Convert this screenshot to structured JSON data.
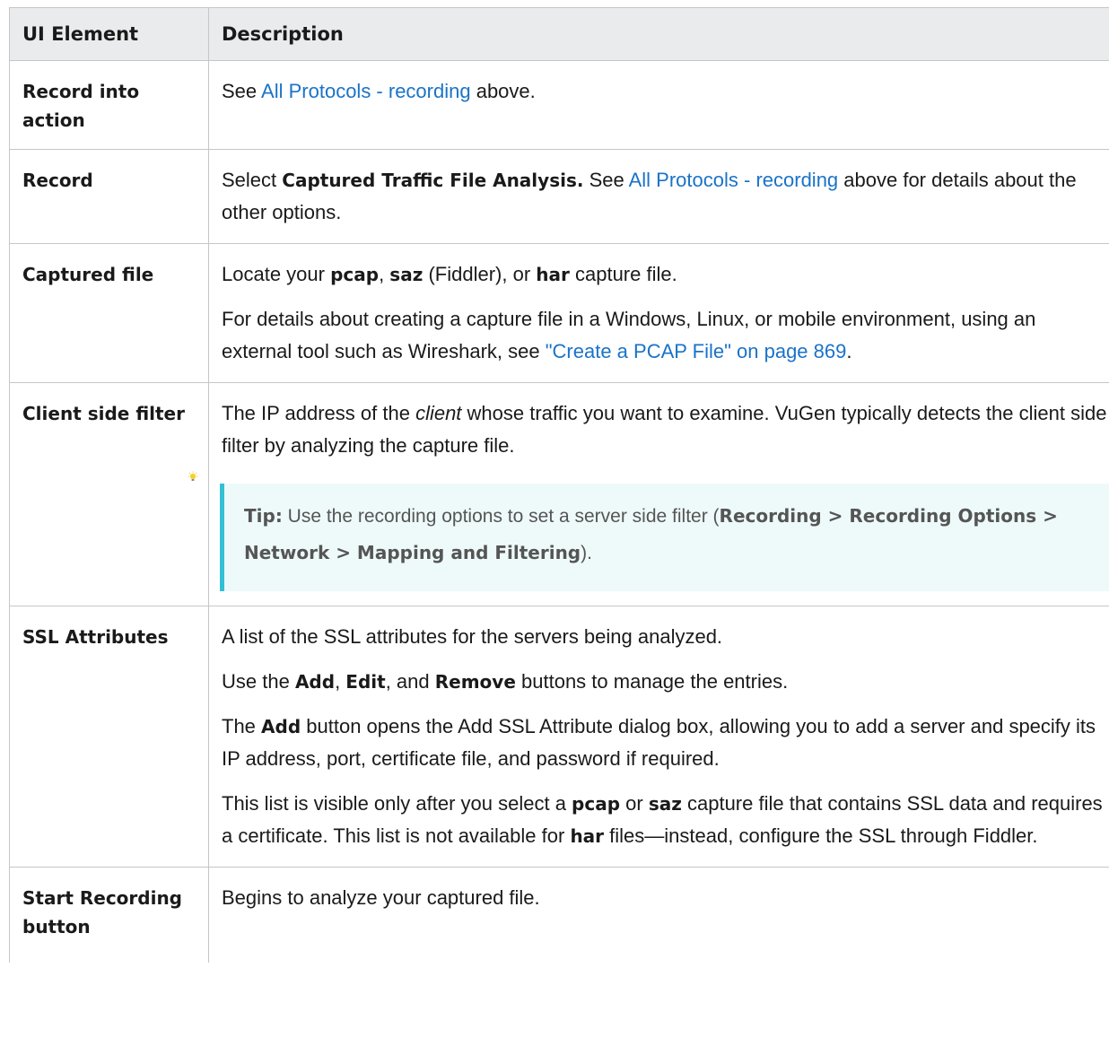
{
  "header": {
    "col1": "UI Element",
    "col2": "Description"
  },
  "rows": {
    "record_into_action": {
      "element": "Record into action",
      "p1": {
        "pre": "See ",
        "link": "All Protocols - recording",
        "post": " above."
      }
    },
    "record": {
      "element": "Record",
      "p1": {
        "pre": "Select ",
        "bold": "Captured Traffic File Analysis.",
        "mid": " See ",
        "link": "All Protocols - recording",
        "post": " above for details about the other options."
      }
    },
    "captured_file": {
      "element": "Captured file",
      "p1": {
        "pre": "Locate your ",
        "b1": "pcap",
        "s1": ", ",
        "b2": "saz",
        "s2": " (Fiddler), or ",
        "b3": "har",
        "post": " capture file."
      },
      "p2": {
        "pre": "For details about creating a capture file in a Windows, Linux, or mobile environment, using an external tool such as Wireshark, see ",
        "link": "\"Create a PCAP File\" on page 869",
        "post": "."
      }
    },
    "client_side_filter": {
      "element": "Client side filter",
      "p1": {
        "pre": "The IP address of the ",
        "italic": "client",
        "post": " whose traffic you want to examine. VuGen typically detects the client side filter by analyzing the capture file."
      },
      "tip": {
        "label": "Tip:",
        "pre": " Use the recording options to set a server side filter (",
        "path": "Recording > Recording Options > Network > Mapping and Filtering",
        "post": ")."
      }
    },
    "ssl_attributes": {
      "element": "SSL Attributes",
      "p1": "A list of the SSL attributes for the servers being analyzed.",
      "p2": {
        "pre": "Use the ",
        "b1": "Add",
        "s1": ", ",
        "b2": "Edit",
        "s2": ", and ",
        "b3": "Remove",
        "post": " buttons to manage the entries."
      },
      "p3": {
        "pre": "The ",
        "bold": "Add",
        "post": " button opens the Add SSL Attribute dialog box, allowing you to add a server and specify its IP address, port, certificate file, and password if required."
      },
      "p4": {
        "pre": "This list is visible only after you select a ",
        "b1": "pcap",
        "s1": " or ",
        "b2": "saz",
        "s2": " capture file that contains SSL data and requires a certificate. This list is not available for ",
        "b3": "har",
        "post": " files—instead, configure the SSL through Fiddler."
      }
    },
    "start_recording": {
      "element": "Start Recording button",
      "p1": "Begins to analyze your captured file."
    }
  },
  "icons": {
    "tip": "lightbulb-icon"
  },
  "colors": {
    "link": "#1a73c8",
    "header_bg": "#e9ebec",
    "tip_bg": "#eefafa",
    "tip_border": "#34c0d4"
  }
}
